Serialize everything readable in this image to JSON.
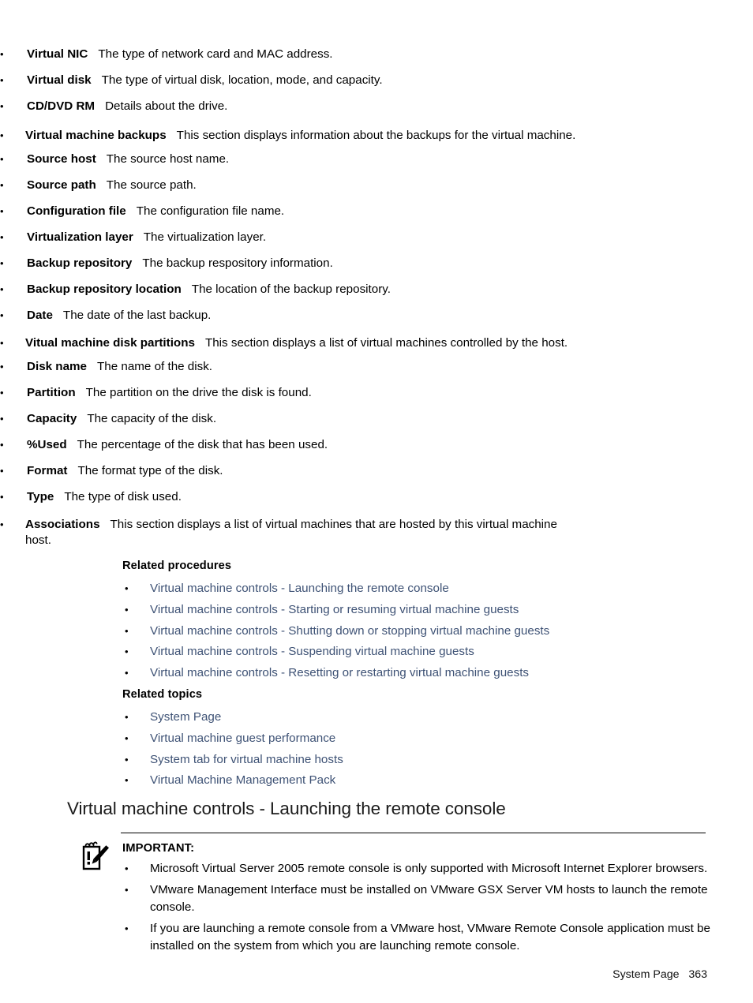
{
  "document": {
    "footer_text": "System Page   363",
    "link_color": "#3e5275",
    "text_color": "#000000"
  },
  "vm_detail_groups": {
    "hardware_items": [
      {
        "term": "Virtual NIC",
        "desc": "The type of network card and MAC address."
      },
      {
        "term": "Virtual disk",
        "desc": "The type of virtual disk, location, mode, and capacity."
      },
      {
        "term": "CD/DVD RM",
        "desc": "Details about the drive."
      }
    ],
    "backups": {
      "term": "Virtual machine backups",
      "desc": "This section displays information about the backups for the virtual machine.",
      "items": [
        {
          "term": "Source host",
          "desc": "The source host name."
        },
        {
          "term": "Source path",
          "desc": "The source path."
        },
        {
          "term": "Configuration file",
          "desc": "The configuration file name."
        },
        {
          "term": "Virtualization layer",
          "desc": "The virtualization layer."
        },
        {
          "term": "Backup repository",
          "desc": "The backup respository information."
        },
        {
          "term": "Backup repository location",
          "desc": "The location of the backup repository."
        },
        {
          "term": "Date",
          "desc": "The date of the last backup."
        }
      ]
    },
    "disk_partitions": {
      "term": "Vitual machine disk partitions",
      "desc": "This section displays a list of virtual machines controlled by the host.",
      "items": [
        {
          "term": "Disk name",
          "desc": "The name of the disk."
        },
        {
          "term": "Partition",
          "desc": "The partition on the drive the disk is found."
        },
        {
          "term": "Capacity",
          "desc": "The capacity of the disk."
        },
        {
          "term": "%Used",
          "desc": "The percentage of the disk that has been used."
        },
        {
          "term": "Format",
          "desc": "The format type of the disk."
        },
        {
          "term": "Type",
          "desc": "The type of disk used."
        }
      ]
    },
    "associations": {
      "term": "Associations",
      "desc": "This section displays a list of virtual machines that are hosted by this virtual machine host."
    }
  },
  "related_procedures": {
    "heading": "Related procedures",
    "links": [
      "Virtual machine controls - Launching the remote console",
      "Virtual machine controls - Starting or resuming virtual machine guests",
      "Virtual machine controls - Shutting down or stopping virtual machine guests",
      "Virtual machine controls - Suspending virtual machine guests",
      "Virtual machine controls - Resetting or restarting virtual machine guests"
    ]
  },
  "related_topics": {
    "heading": "Related topics",
    "links": [
      "System Page",
      "Virtual machine guest performance",
      "System tab for virtual machine hosts",
      "Virtual Machine Management Pack"
    ]
  },
  "section": {
    "heading": "Virtual machine controls - Launching the remote console"
  },
  "important_note": {
    "icon": "note-pencil-icon",
    "label": "IMPORTANT:",
    "items": [
      "Microsoft Virtual Server 2005 remote console is only supported with Microsoft Internet Explorer browsers.",
      "VMware Management Interface must be installed on VMware GSX Server VM hosts to launch the remote console.",
      "If you are launching a remote console from a VMware host, VMware Remote Console application must be installed on the system from which you are launching remote console."
    ]
  }
}
